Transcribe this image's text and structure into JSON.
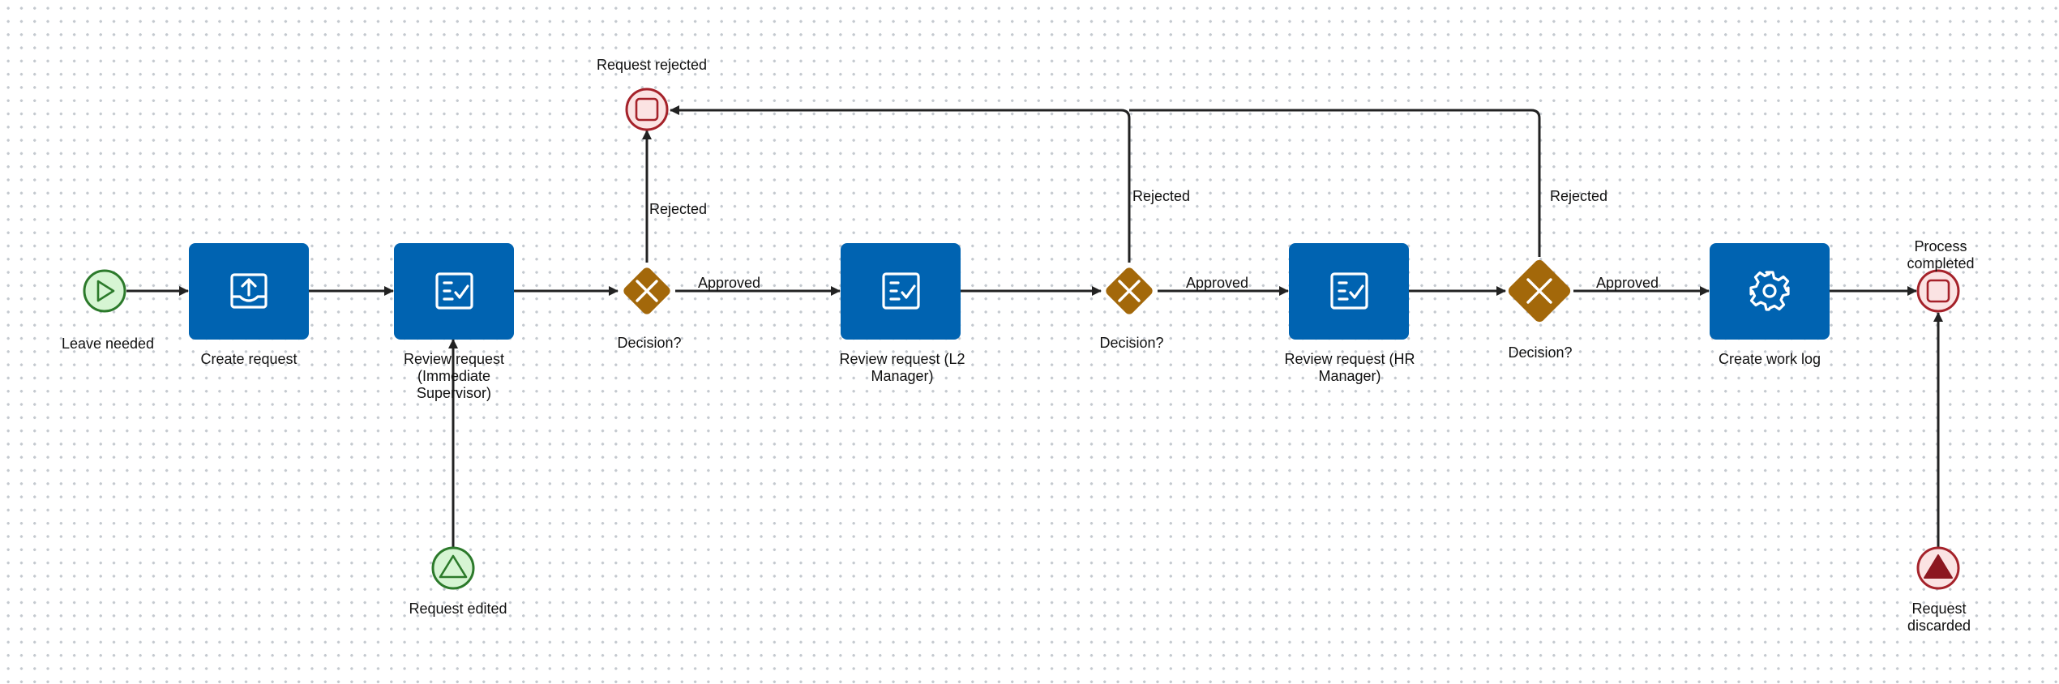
{
  "colors": {
    "task": "#0063b1",
    "gateway": "#a3680a",
    "start_fill": "#d6f5d3",
    "start_stroke": "#2c7a2b",
    "end_fill": "#fbe3e3",
    "end_stroke": "#a5222a",
    "flow": "#222222"
  },
  "events": {
    "leave_needed": {
      "label": "Leave needed",
      "icon": "play-icon"
    },
    "request_edited": {
      "label": "Request edited",
      "icon": "triangle-outline-icon"
    },
    "request_rejected": {
      "label": "Request rejected",
      "icon": "stop-square-icon"
    },
    "process_completed": {
      "label_line1": "Process",
      "label_line2": "completed",
      "icon": "stop-square-icon"
    },
    "request_discarded": {
      "label_line1": "Request",
      "label_line2": "discarded",
      "icon": "triangle-filled-icon"
    }
  },
  "tasks": {
    "create_request": {
      "label": "Create request",
      "icon": "upload-tray-icon"
    },
    "review_supervisor": {
      "label_line1": "Review request",
      "label_line2": "(Immediate",
      "label_line3": "Supervisor)",
      "icon": "checklist-icon"
    },
    "review_l2": {
      "label_line1": "Review request (L2",
      "label_line2": "Manager)",
      "icon": "checklist-icon"
    },
    "review_hr": {
      "label_line1": "Review request (HR",
      "label_line2": "Manager)",
      "icon": "checklist-icon"
    },
    "create_work_log": {
      "label": "Create work log",
      "icon": "gear-icon"
    }
  },
  "gateways": {
    "decision_1": {
      "label": "Decision?",
      "icon": "close-x-icon"
    },
    "decision_2": {
      "label": "Decision?",
      "icon": "close-x-icon"
    },
    "decision_3": {
      "label": "Decision?",
      "icon": "close-x-icon"
    }
  },
  "flows": {
    "d1_rejected": "Rejected",
    "d1_approved": "Approved",
    "d2_rejected": "Rejected",
    "d2_approved": "Approved",
    "d3_rejected": "Rejected",
    "d3_approved": "Approved"
  }
}
